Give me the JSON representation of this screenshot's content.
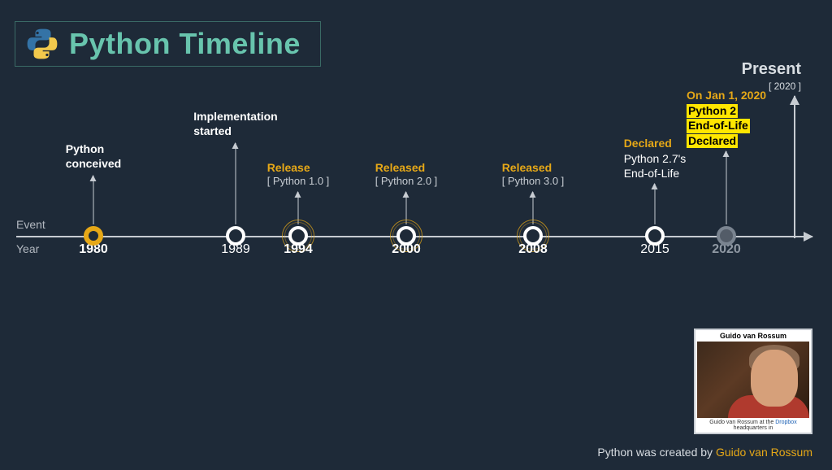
{
  "title": "Python Timeline",
  "present": {
    "label": "Present",
    "year": "[ 2020 ]"
  },
  "axis": {
    "event": "Event",
    "year": "Year"
  },
  "events": {
    "e0": {
      "year": "1980",
      "line1": "Python",
      "line2": "conceived"
    },
    "e1": {
      "year": "1989",
      "line1": "Implementation",
      "line2": "started"
    },
    "e2": {
      "year": "1994",
      "line1": "Release",
      "sub": "[ Python 1.0 ]"
    },
    "e3": {
      "year": "2000",
      "line1": "Released",
      "sub": "[ Python 2.0 ]"
    },
    "e4": {
      "year": "2008",
      "line1": "Released",
      "sub": "[ Python 3.0 ]"
    },
    "e5": {
      "year": "2015",
      "line1": "Declared",
      "sub1": "Python 2.7's",
      "sub2": "End-of-Life"
    },
    "e6": {
      "year": "2020",
      "line1": "On Jan 1, 2020",
      "hl1": "Python 2",
      "hl2": "End-of-Life",
      "hl3": "Declared"
    }
  },
  "credit": {
    "prefix": "Python was created by ",
    "name": "Guido van Rossum"
  },
  "photo": {
    "name": "Guido van Rossum",
    "cap_a": "Guido van Rossum at the ",
    "cap_link": "Dropbox",
    "cap_b": " headquarters in"
  }
}
